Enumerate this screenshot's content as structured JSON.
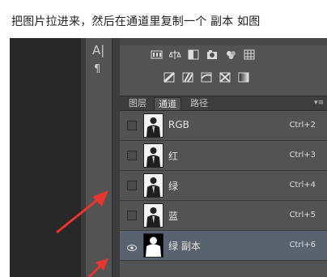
{
  "caption": "把图片拉进来，然后在通道里复制一个 副本 如图",
  "toolbar": {
    "type_icon": "A|",
    "paragraph_icon": "¶"
  },
  "tabs": [
    "图层",
    "通道",
    "路径"
  ],
  "menu_icon": "▾≡",
  "channels": [
    {
      "name": "RGB",
      "shortcut": "Ctrl+2"
    },
    {
      "name": "红",
      "shortcut": "Ctrl+3"
    },
    {
      "name": "绿",
      "shortcut": "Ctrl+4"
    },
    {
      "name": "蓝",
      "shortcut": "Ctrl+5"
    },
    {
      "name": "绿 副本",
      "shortcut": "Ctrl+6"
    }
  ],
  "colors": {
    "selected_row": "#59626f",
    "arrow": "#e8352f"
  }
}
